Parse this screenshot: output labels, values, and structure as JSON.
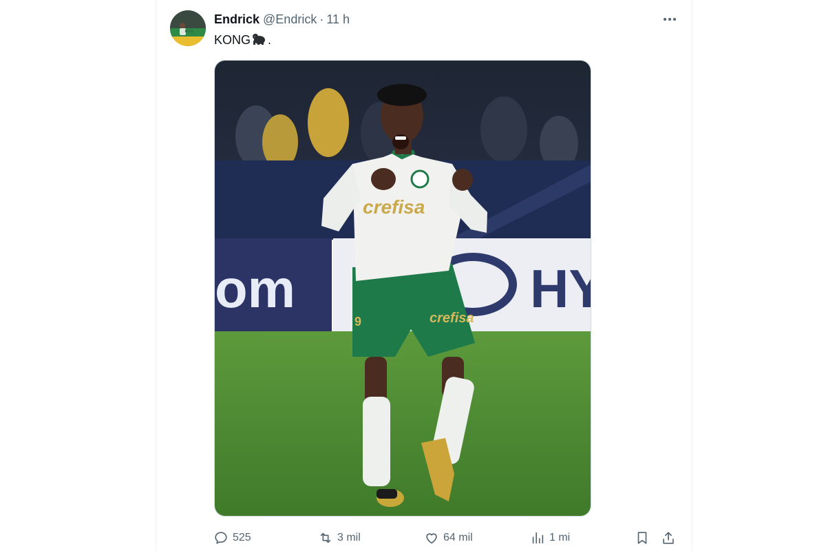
{
  "tweet": {
    "display_name": "Endrick",
    "handle": "@Endrick",
    "separator": "·",
    "time": "11 h",
    "text": "KONG",
    "text_suffix": ".",
    "text_emoji": "gorilla-icon"
  },
  "media": {
    "jersey_sponsor": "crefisa",
    "shorts_sponsor": "crefisa",
    "shirt_number": "9",
    "board_left_text": "om",
    "board_right_text": "HY"
  },
  "actions": {
    "replies": "525",
    "retweets": "3 mil",
    "likes": "64 mil",
    "views": "1 mi"
  },
  "icons": {
    "more": "more-dots-icon",
    "reply": "reply-icon",
    "retweet": "retweet-icon",
    "like": "heart-icon",
    "views": "views-chart-icon",
    "bookmark": "bookmark-icon",
    "share": "share-icon"
  },
  "colors": {
    "text_primary": "#0f1419",
    "text_secondary": "#536471",
    "pitch_green": "#4f8a35",
    "kit_green": "#1f7a4a",
    "sponsor_gold": "#c9a94a"
  }
}
